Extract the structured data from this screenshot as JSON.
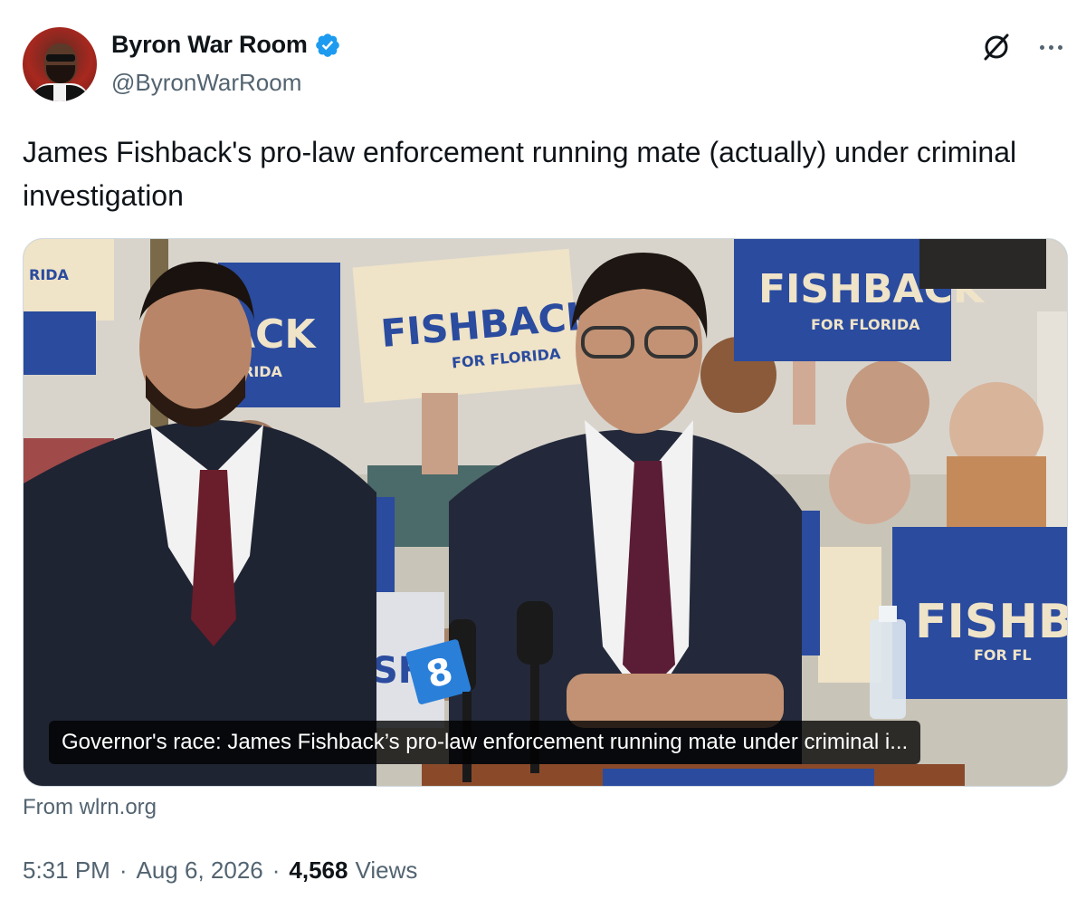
{
  "author": {
    "display_name": "Byron War Room",
    "handle": "@ByronWarRoom",
    "verified": true
  },
  "icons": {
    "verified": "verified-badge-icon",
    "grok": "grok-icon",
    "more": "more-icon"
  },
  "tweet": {
    "text": "James Fishback's pro-law enforcement running mate (actually) under criminal investigation"
  },
  "card": {
    "caption": "Governor's race: James Fishback’s pro-law enforcement running mate under criminal i...",
    "source": "From wlrn.org",
    "sign_main": "FISHBACK",
    "sign_sub": "FOR FLORIDA",
    "sign_partial_1": "ACK",
    "sign_partial_2": "RIDA",
    "sign_partial_3": "FISHBA",
    "sign_partial_4": "FOR FL",
    "sign_partial_5": "SHB",
    "mic_flag": "8"
  },
  "meta": {
    "time": "5:31 PM",
    "date": "Aug 6, 2026",
    "separator": "·",
    "views_count": "4,568",
    "views_label": "Views"
  },
  "colors": {
    "verified_blue": "#1d9bf0",
    "sign_blue": "#2a4b9e",
    "sign_cream": "#efe3c8",
    "text_secondary": "#536471"
  }
}
